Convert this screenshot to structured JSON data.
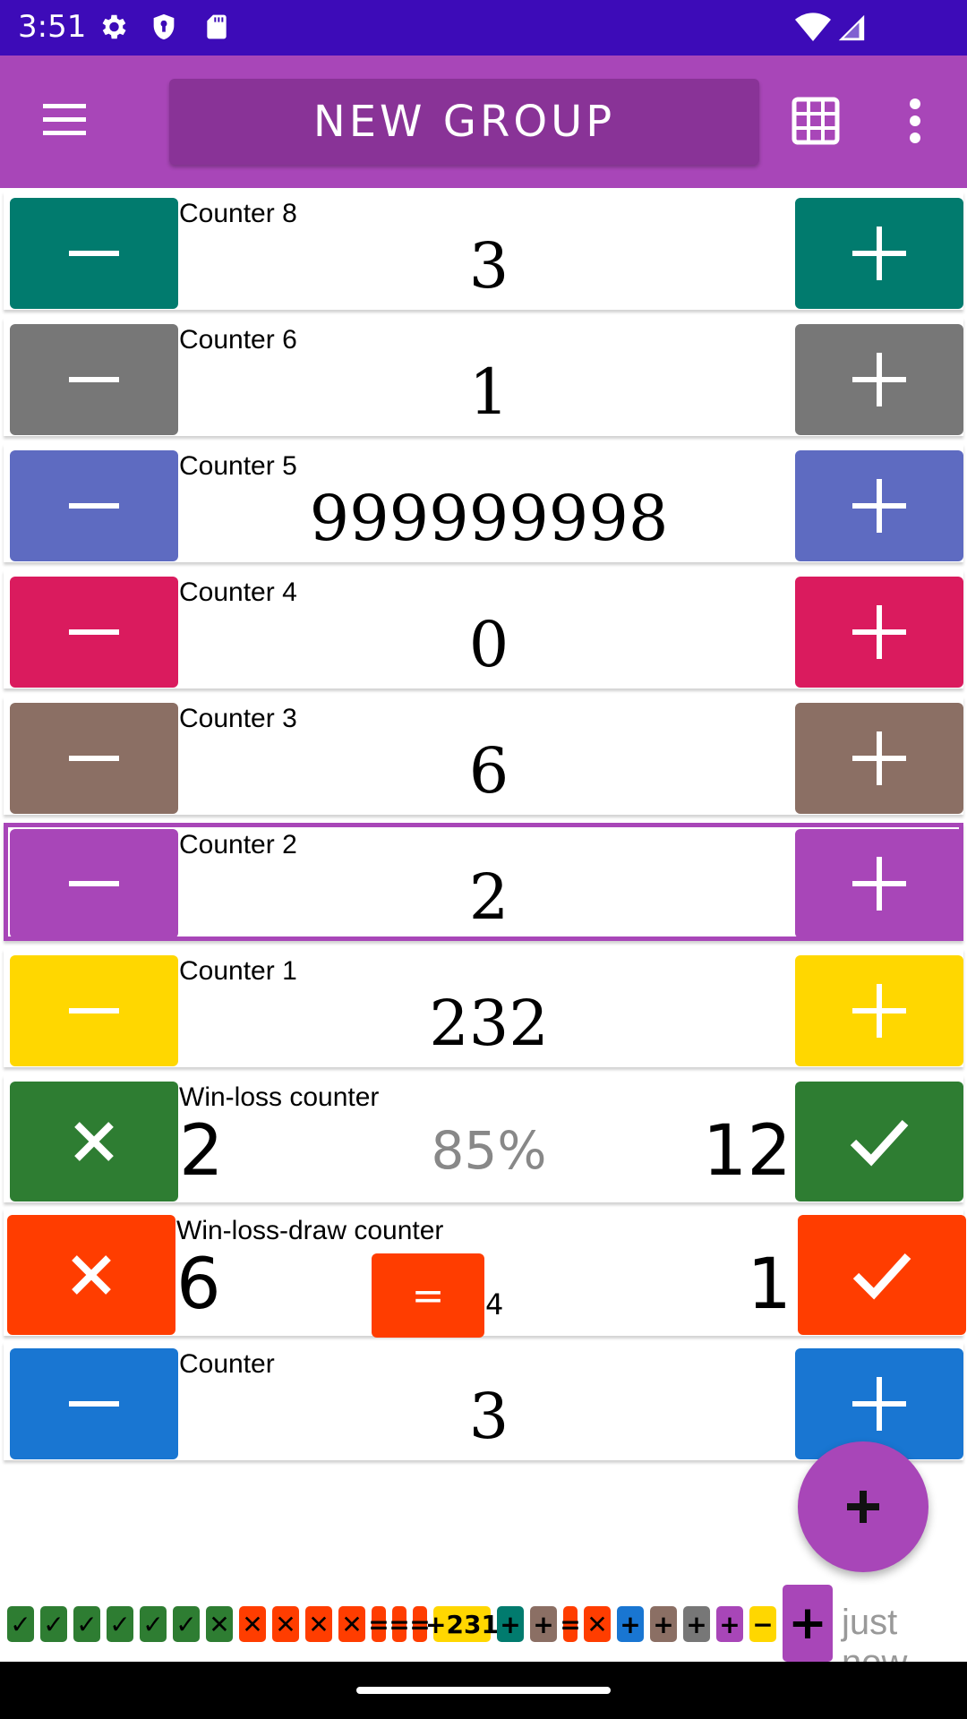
{
  "status_bar": {
    "time": "3:51"
  },
  "toolbar": {
    "title": "NEW GROUP",
    "menu_icon": "hamburger-menu-icon",
    "grid_icon": "grid-view-icon",
    "more_icon": "more-vert-icon"
  },
  "counters": [
    {
      "name": "Counter 8",
      "value": "3",
      "color": "#017b6e"
    },
    {
      "name": "Counter 6",
      "value": "1",
      "color": "#777777"
    },
    {
      "name": "Counter 5",
      "value": "999999998",
      "color": "#5e6bc1"
    },
    {
      "name": "Counter 4",
      "value": "0",
      "color": "#da1b5e"
    },
    {
      "name": "Counter 3",
      "value": "6",
      "color": "#8b6f64"
    },
    {
      "name": "Counter 2",
      "value": "2",
      "color": "#a846b8",
      "selected": true
    },
    {
      "name": "Counter 1",
      "value": "232",
      "color": "#ffd700"
    }
  ],
  "win_loss": {
    "name": "Win-loss counter",
    "losses": "2",
    "percent": "85%",
    "wins": "12",
    "color": "#2e7d32"
  },
  "win_loss_draw": {
    "name": "Win-loss-draw counter",
    "losses": "6",
    "draw_label": "=",
    "draws": "4",
    "wins": "1",
    "color": "#ff3d00"
  },
  "last_counter": {
    "name": "Counter",
    "value": "3",
    "color": "#1976d2"
  },
  "fab": {
    "icon": "plus-icon"
  },
  "history": {
    "timestamp": "just now",
    "chips": [
      {
        "label": "✓",
        "color": "#2e7d32"
      },
      {
        "label": "✓",
        "color": "#2e7d32"
      },
      {
        "label": "✓",
        "color": "#2e7d32"
      },
      {
        "label": "✓",
        "color": "#2e7d32"
      },
      {
        "label": "✓",
        "color": "#2e7d32"
      },
      {
        "label": "✓",
        "color": "#2e7d32"
      },
      {
        "label": "✕",
        "color": "#2e7d32"
      },
      {
        "label": "✕",
        "color": "#ff3d00"
      },
      {
        "label": "✕",
        "color": "#ff3d00"
      },
      {
        "label": "✕",
        "color": "#ff3d00"
      },
      {
        "label": "✕",
        "color": "#ff3d00"
      },
      {
        "label": "=",
        "color": "#ff3d00"
      },
      {
        "label": "=",
        "color": "#ff3d00"
      },
      {
        "label": "=",
        "color": "#ff3d00"
      },
      {
        "label": "+231",
        "color": "#ffd700"
      },
      {
        "label": "+",
        "color": "#017b6e"
      },
      {
        "label": "+",
        "color": "#8b6f64"
      },
      {
        "label": "=",
        "color": "#ff3d00"
      },
      {
        "label": "✕",
        "color": "#ff3d00"
      },
      {
        "label": "+",
        "color": "#1976d2"
      },
      {
        "label": "+",
        "color": "#8b6f64"
      },
      {
        "label": "+",
        "color": "#777777"
      },
      {
        "label": "+",
        "color": "#a846b8"
      },
      {
        "label": "−",
        "color": "#ffd700"
      },
      {
        "label": "+",
        "color": "#a846b8"
      }
    ]
  }
}
